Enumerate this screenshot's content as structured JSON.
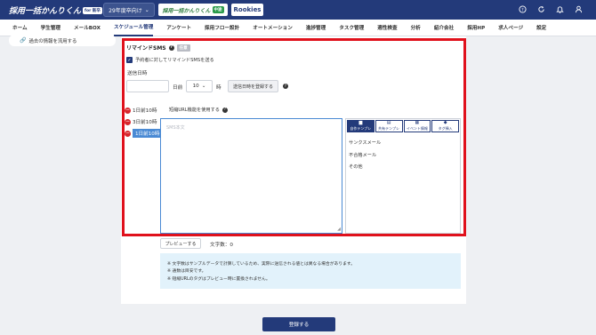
{
  "header": {
    "brand_main": "採用一括かんりくん",
    "brand_sub": "for 新卒",
    "year_select": "29年度卒向け",
    "kanri_logo": "採用一括かんりくん",
    "kanri_tag": "中途",
    "rookies_logo": "Rookies",
    "icons": [
      "help-icon",
      "refresh-icon",
      "bell-icon",
      "user-icon"
    ]
  },
  "nav": {
    "items": [
      "ホーム",
      "学生管理",
      "メールBOX",
      "スケジュール管理",
      "アンケート",
      "採用フロー設計",
      "オートメーション",
      "進捗管理",
      "タスク管理",
      "適性検査",
      "分析",
      "紹介会社",
      "採用HP",
      "求人ページ",
      "設定"
    ],
    "active_index": 3
  },
  "sidebar": {
    "past_info_link": "過去の情報を流用する"
  },
  "remind": {
    "title": "リマインドSMS",
    "badge": "任意",
    "checkbox_label": "予約者に対してリマインドSMSを送る",
    "checkbox_checked": true,
    "send_datetime_label": "送信日時",
    "days_value": "",
    "days_unit": "日前",
    "hour_value": "10",
    "hour_unit": "時",
    "register_time_button": "送信日時を登録する",
    "short_url_label": "短縮URL機能を使用する",
    "day_tabs": [
      "1日前10時",
      "3日前10時",
      "1日前10時"
    ],
    "active_day_tab": 2,
    "sms_placeholder": "SMS本文",
    "template_tabs": [
      "自作テンプレ",
      "共有テンプレ",
      "イベント情報",
      "タグ挿入"
    ],
    "template_tab_icons": [
      "folder-icon",
      "book-icon",
      "calendar-icon",
      "tag-icon"
    ],
    "template_items": [
      "サンクスメール",
      "不合格メール",
      "その他"
    ],
    "preview_button": "プレビューする",
    "char_count_label": "文字数：0",
    "notes": [
      "※ 文字数はサンプルデータで計算しているため、実際に送信される値とは異なる場合があります。",
      "※ 通数は目安です。",
      "※ 短縮URLのタグはプレビュー時に置換されません。"
    ],
    "submit_button": "登録する"
  }
}
